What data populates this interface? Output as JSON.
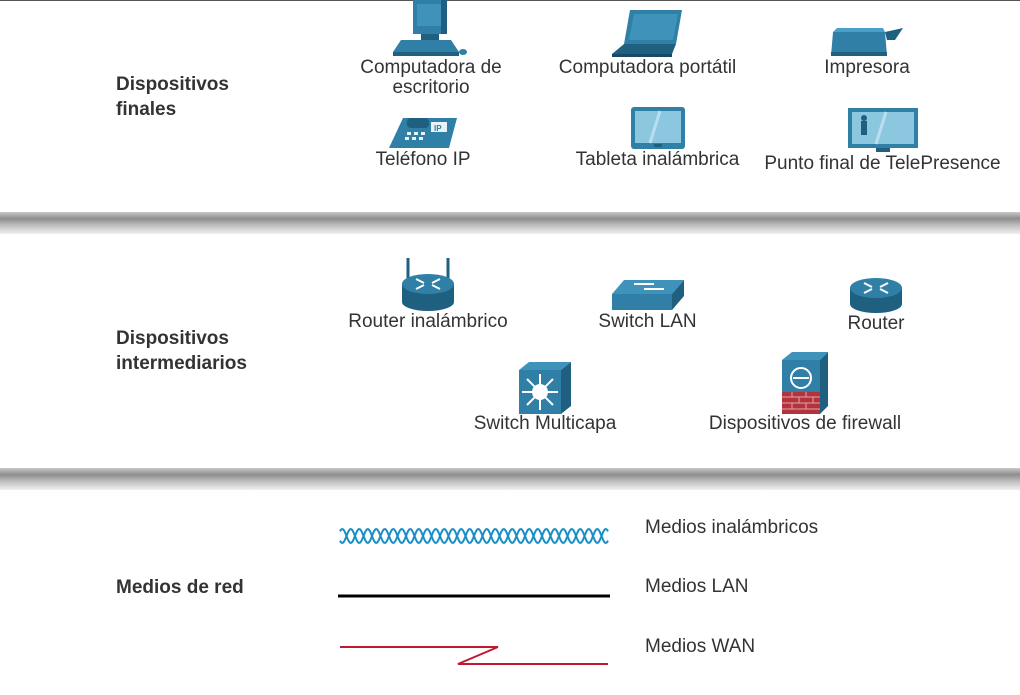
{
  "sections": {
    "end": {
      "title_line1": "Dispositivos",
      "title_line2": "finales"
    },
    "intermediate": {
      "title_line1": "Dispositivos",
      "title_line2": "intermediarios"
    },
    "media": {
      "title": "Medios de red"
    }
  },
  "end_devices": {
    "desktop": {
      "label_line1": "Computadora de",
      "label_line2": "escritorio",
      "icon": "desktop-computer-icon"
    },
    "laptop": {
      "label": "Computadora portátil",
      "icon": "laptop-icon"
    },
    "printer": {
      "label": "Impresora",
      "icon": "printer-icon"
    },
    "ip_phone": {
      "label": "Teléfono IP",
      "icon": "ip-phone-icon"
    },
    "tablet": {
      "label": "Tableta inalámbrica",
      "icon": "tablet-icon"
    },
    "telepresence": {
      "label": "Punto final de TelePresence",
      "icon": "telepresence-icon"
    }
  },
  "intermediate_devices": {
    "wireless_router": {
      "label": "Router inalámbrico",
      "icon": "wireless-router-icon"
    },
    "lan_switch": {
      "label": "Switch LAN",
      "icon": "lan-switch-icon"
    },
    "router": {
      "label": "Router",
      "icon": "router-icon"
    },
    "multilayer_switch": {
      "label": "Switch Multicapa",
      "icon": "multilayer-switch-icon"
    },
    "firewall": {
      "label": "Dispositivos de firewall",
      "icon": "firewall-icon"
    }
  },
  "media": {
    "wireless": {
      "label": "Medios inalámbricos",
      "color": "#1a8fc7"
    },
    "lan": {
      "label": "Medios LAN",
      "color": "#000000"
    },
    "wan": {
      "label": "Medios WAN",
      "color": "#c0192f"
    }
  },
  "colors": {
    "icon_blue": "#2f7fa6",
    "icon_dark": "#1f5f80",
    "text": "#333333"
  }
}
